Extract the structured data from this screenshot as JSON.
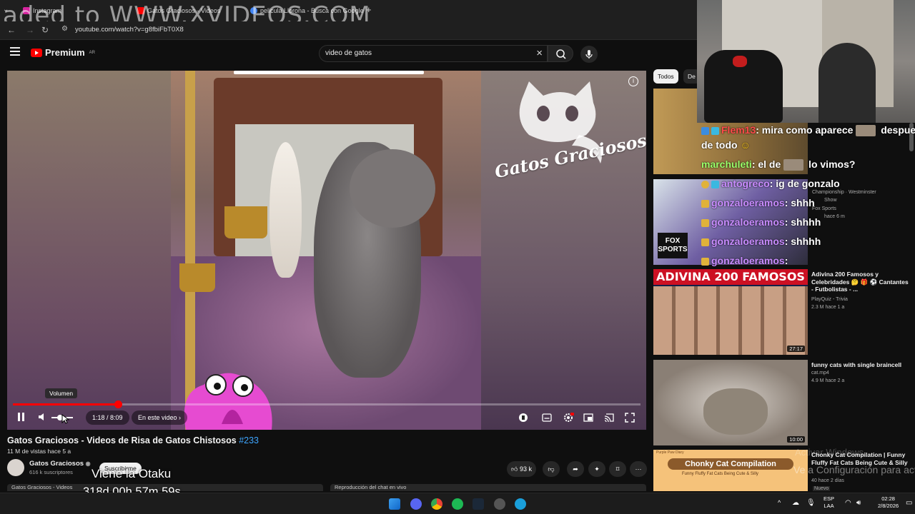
{
  "browser": {
    "watermark": "aded to WWW.XVIDEOS.COM",
    "tabs": [
      {
        "label": "Instagram",
        "color": "#d6249f"
      },
      {
        "label": "Gatos Graciosos - Videos",
        "color": "#ff0000"
      },
      {
        "label": "pelicula Llorona - Busca con Google",
        "color": "#4285f4"
      }
    ],
    "url": "youtube.com/watch?v=g8fbiFbT0X8"
  },
  "youtube_header": {
    "logo": "Premium",
    "logo_sup": "AR",
    "search_value": "video de gatos"
  },
  "player": {
    "brand_text": "Gatos Graciosos",
    "volume_tooltip": "Volumen",
    "time": "1:18 / 8:09",
    "chapter": "En este video",
    "progress_fraction": 0.167,
    "icons": [
      "pause-icon",
      "volume-icon",
      "autoplay-icon",
      "subtitles-icon",
      "settings-icon",
      "miniplayer-icon",
      "cast-icon",
      "fullscreen-icon"
    ]
  },
  "video": {
    "title": "Gatos Graciosos - Videos de Risa de Gatos Chistosos",
    "tag": "#233",
    "meta": "11 M de vistas  hace 5 a",
    "channel": "Gatos Graciosos",
    "subs": "616 k suscriptores",
    "subscribe": "Suscribirme",
    "likes": "93 k"
  },
  "stream_overlay": {
    "name": "Viene la Otaku",
    "timer": "318d 00h 57m 59s"
  },
  "bottom_tabs": [
    "Gatos Graciosos - Videos",
    "Reproducción del chat en vivo"
  ],
  "filters": [
    "Todos",
    "De"
  ],
  "chat": [
    {
      "user": "Flem13",
      "user_color": "#ff4a4a",
      "text": ": mira como aparece",
      "tail": " despues"
    },
    {
      "user": "",
      "text": "de todo"
    },
    {
      "user": "marchuleti",
      "user_color": "#9aff6a",
      "text": ": el de",
      "tail": " lo vimos?"
    },
    {
      "user": "antogreco",
      "user_color": "#c98cff",
      "text": ": ig de gonzalo"
    },
    {
      "user": "gonzaloeramos",
      "user_color": "#c98cff",
      "text": ": shhh"
    },
    {
      "user": "gonzaloeramos",
      "user_color": "#c98cff",
      "text": ": shhhh"
    },
    {
      "user": "gonzaloeramos",
      "user_color": "#c98cff",
      "text": ": shhhh"
    },
    {
      "user": "gonzaloeramos",
      "user_color": "#c98cff",
      "text": ":"
    }
  ],
  "recs": [
    {
      "title": "",
      "sub1": "Championship · Westminster",
      "sub2": "Show",
      "sub3": "Fox Sports",
      "sub4": "hace 6 m",
      "badge": "FOX SPORTS"
    },
    {
      "title": "Adivina 200 Famosos y Celebridades 🤔 🎁 ⚽ Cantantes - Futbolistas - ...",
      "sub1": "PlayQuiz - Trivia",
      "sub2": "2.3 M  hace 1 a",
      "thumb_text": "ADIVINA 200 FAMOSOS",
      "duration": "27:17"
    },
    {
      "title": "funny cats with single braincell",
      "sub1": "cat.mp4",
      "sub2": "4.9 M  hace 2 a",
      "duration": "10:00"
    },
    {
      "title": "Chonky Cat Compilation | Funny Fluffy Fat Cats Being Cute & Silly",
      "sub1": "Purple Paw Diary",
      "sub2": "40  hace 2 días",
      "sub3": "Nuevo",
      "thumb_text": "Chonky Cat Compilation",
      "thumb_sub": "Funny Fluffy Fat Cats Being Cute & Silly"
    }
  ],
  "windows_notice": {
    "line1": "Activar Windows",
    "line2": "Ve a Configuración para activar Windows"
  },
  "taskbar": {
    "lang1": "ESP",
    "lang2": "LAA",
    "time": "02:28",
    "date": "2/8/2026"
  }
}
